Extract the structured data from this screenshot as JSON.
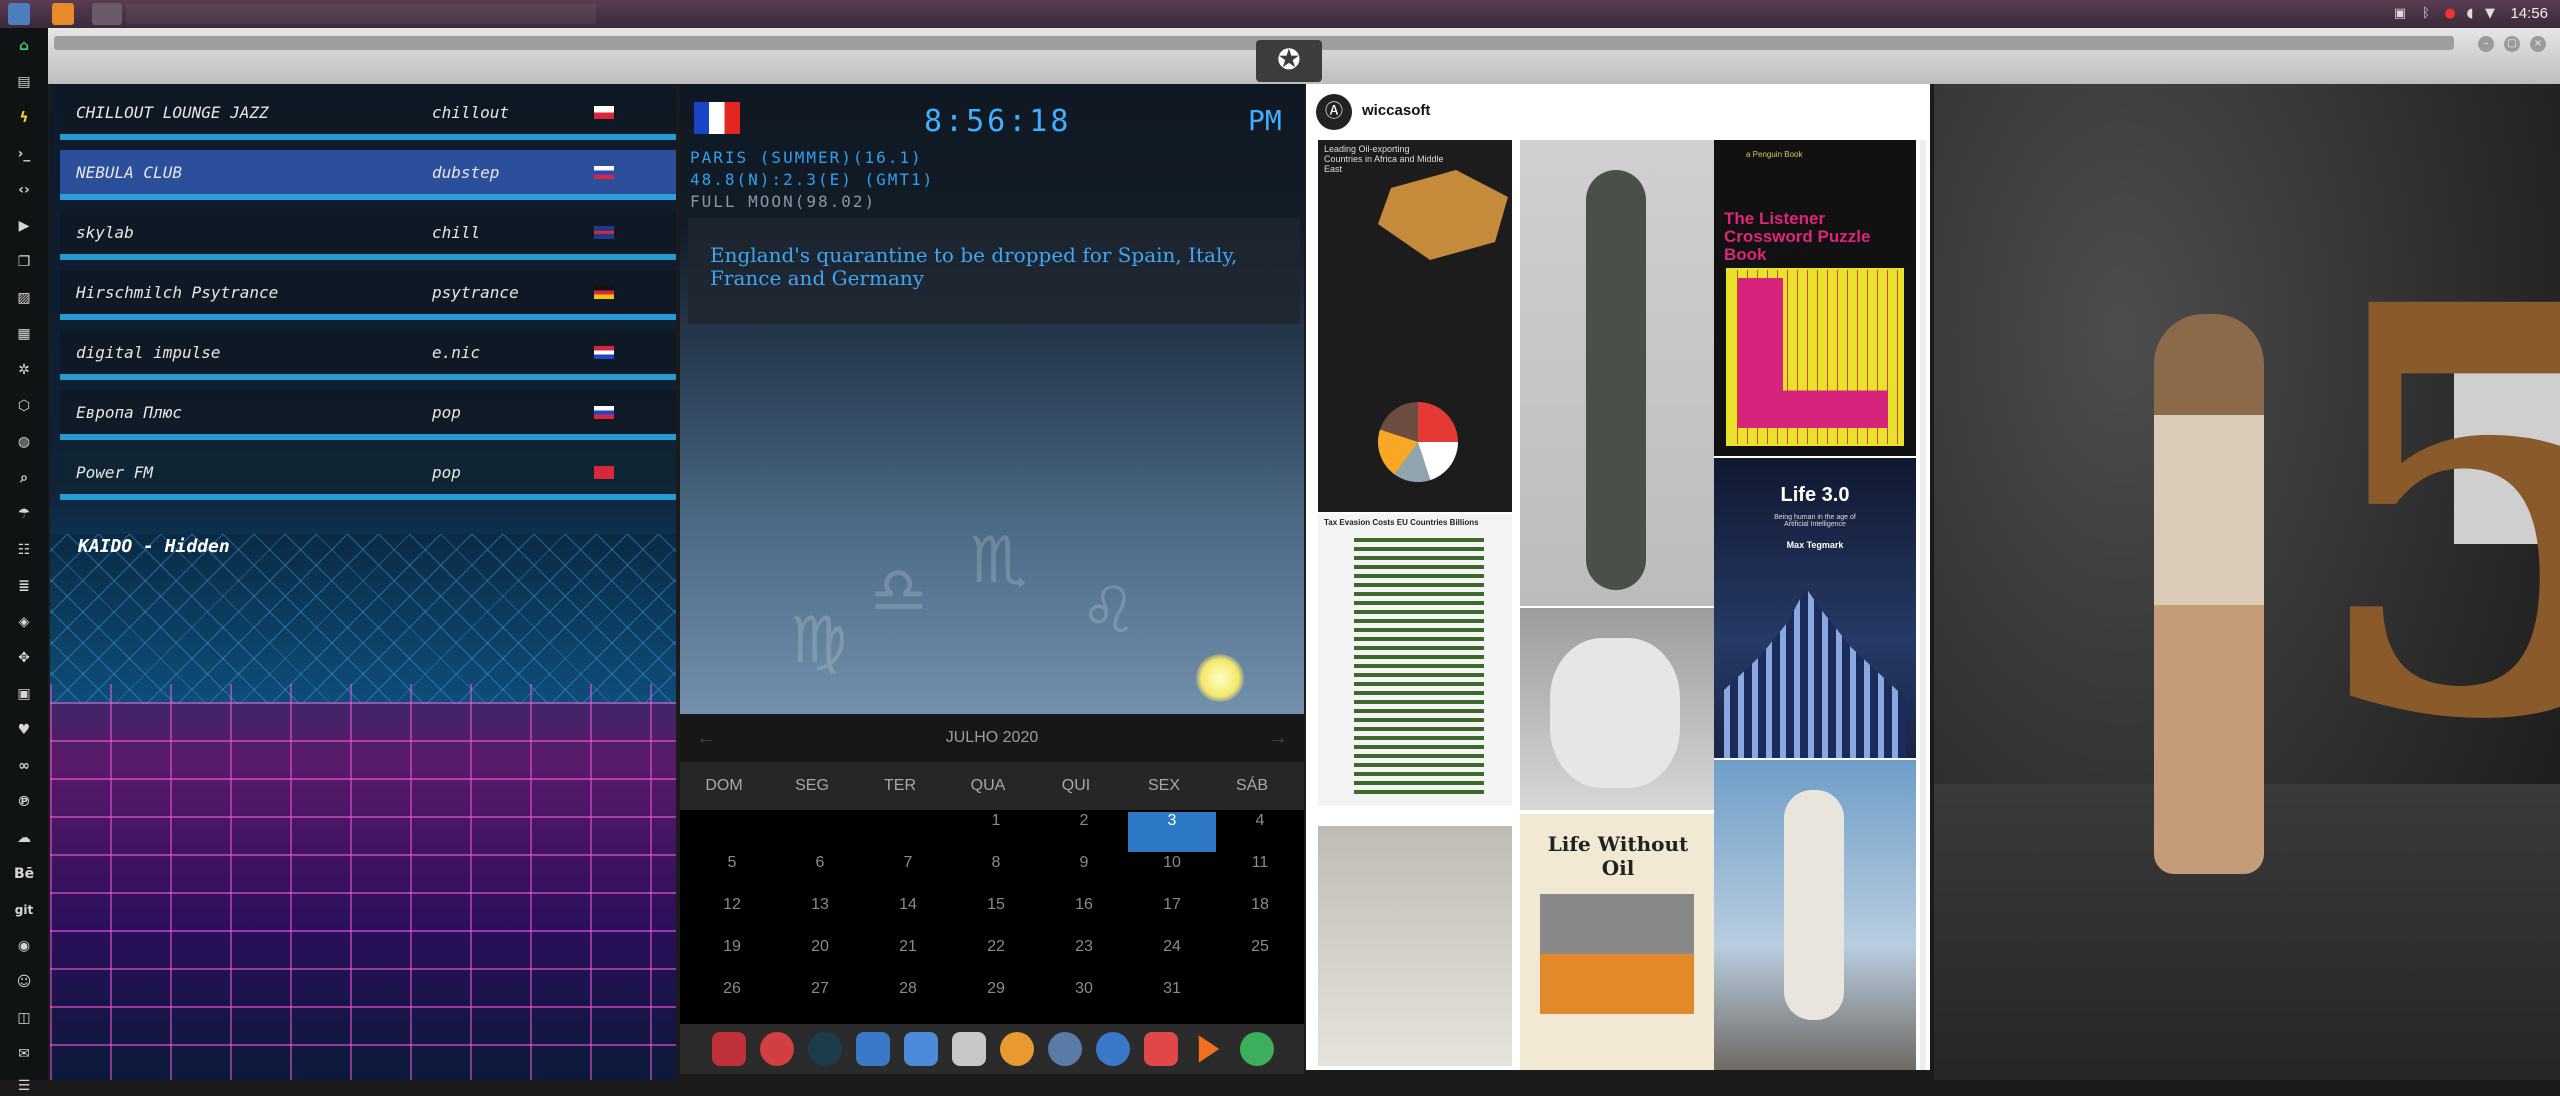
{
  "topbar": {
    "clock": "14:56"
  },
  "radio": {
    "stations": [
      {
        "name": "CHILLOUT LOUNGE JAZZ",
        "genre": "chillout",
        "flag": "poland"
      },
      {
        "name": "NEBULA CLUB",
        "genre": "dubstep",
        "flag": "russia"
      },
      {
        "name": "skylab",
        "genre": "chill",
        "flag": "uk"
      },
      {
        "name": "Hirschmilch Psytrance",
        "genre": "psytrance",
        "flag": "germany"
      },
      {
        "name": "digital impulse",
        "genre": "e.nic",
        "flag": "croatia"
      },
      {
        "name": "Европа Плюс",
        "genre": "pop",
        "flag": "russia"
      },
      {
        "name": "Power FM",
        "genre": "pop",
        "flag": "turkey"
      }
    ],
    "now_playing": "KAIDO - Hidden"
  },
  "weather": {
    "time": "8:56:18",
    "ampm": "PM",
    "line1": "PARIS (SUMMER)(16.1)",
    "line2": "48.8(N):2.3(E) (GMT1)",
    "line3": "FULL MOON(98.02)",
    "news": "England's quarantine to be dropped for Spain, Italy, France and Germany"
  },
  "calendar": {
    "month": "JULHO 2020",
    "weekdays": [
      "DOM",
      "SEG",
      "TER",
      "QUA",
      "QUI",
      "SEX",
      "SÁB"
    ],
    "weeks": [
      [
        "",
        "",
        "",
        "1",
        "2",
        "3",
        "4"
      ],
      [
        "5",
        "6",
        "7",
        "8",
        "9",
        "10",
        "11"
      ],
      [
        "12",
        "13",
        "14",
        "15",
        "16",
        "17",
        "18"
      ],
      [
        "19",
        "20",
        "21",
        "22",
        "23",
        "24",
        "25"
      ],
      [
        "26",
        "27",
        "28",
        "29",
        "30",
        "31",
        ""
      ]
    ],
    "today": "3"
  },
  "pinterest": {
    "user": "wiccasoft",
    "tiles": {
      "oil_title": "Leading Oil-exporting Countries in Africa and Middle East",
      "tax_title": "Tax Evasion Costs EU Countries Billions",
      "lwo_title": "Life Without Oil",
      "book_publisher": "a Penguin Book",
      "book_title": "The Listener Crossword Puzzle Book",
      "life_title": "Life 3.0",
      "life_sub": "Being human in the age of Artificial Intelligence",
      "life_author": "Max Tegmark"
    }
  },
  "colors": {
    "accent": "#3fb0ff",
    "today": "#2e78c8",
    "station_active": "#2c4f9c"
  }
}
